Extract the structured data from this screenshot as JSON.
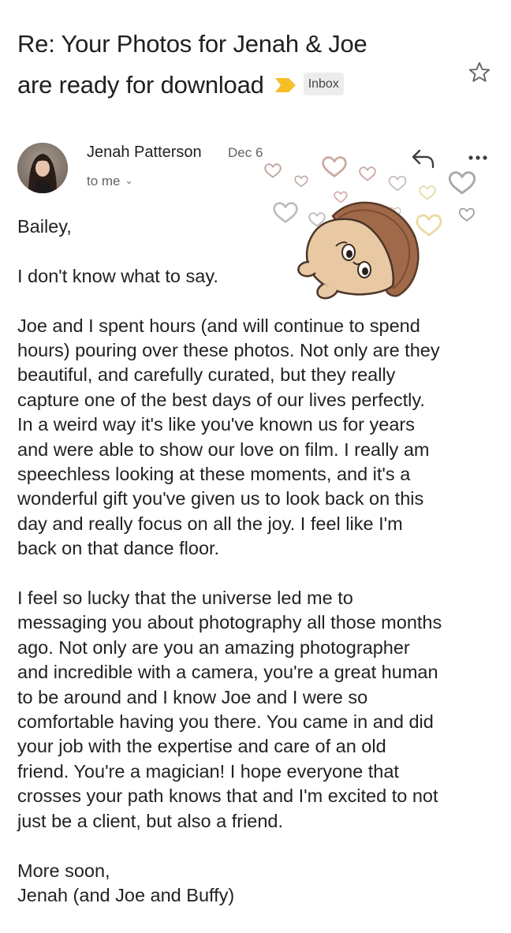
{
  "email": {
    "subject_lines": [
      "Re: Your Photos for Jenah & Joe",
      "are ready for download"
    ],
    "label": "Inbox",
    "sender_name": "Jenah Patterson",
    "date": "Dec 6",
    "recipients": "to me",
    "body": {
      "greeting": "Bailey,",
      "p1": "I don't know what to say.",
      "p2_lines": [
        "Joe and I spent hours (and will continue to spend",
        "hours) pouring over these photos. Not only are they",
        "beautiful, and carefully curated, but they really",
        "capture one of the best days of our lives perfectly.",
        "In a weird way it's like you've known us for years",
        "and were able to show our love on film. I really am",
        "speechless looking at these moments, and it's a",
        "wonderful gift you've given us to look back on this",
        "day and really focus on all the joy. I feel like I'm",
        "back on that dance floor."
      ],
      "p3_lines": [
        "I feel so lucky that the universe led me to",
        "messaging you about photography all those months",
        "ago. Not only are you an amazing photographer",
        "and incredible with a camera, you're a great human",
        "to be around and I know Joe and I were so",
        "comfortable having you there. You came in and did",
        "your job with the expertise and care of an old",
        "friend. You're a magician! I hope everyone that",
        "crosses your path knows that and I'm excited to not",
        "just be a client, but also a friend."
      ],
      "closing_lines": [
        "More soon,",
        "Jenah (and Joe and Buffy)"
      ]
    }
  },
  "icons": {
    "star": "star-outline-icon",
    "importance": "importance-marker-icon",
    "reply": "reply-icon",
    "more": "more-vert-dots-icon",
    "sticker": "love-hearts-sticker"
  },
  "colors": {
    "importance_marker": "#f6bf26",
    "label_bg": "#ececec",
    "meta_gray": "#5f6368",
    "text": "#222222"
  }
}
